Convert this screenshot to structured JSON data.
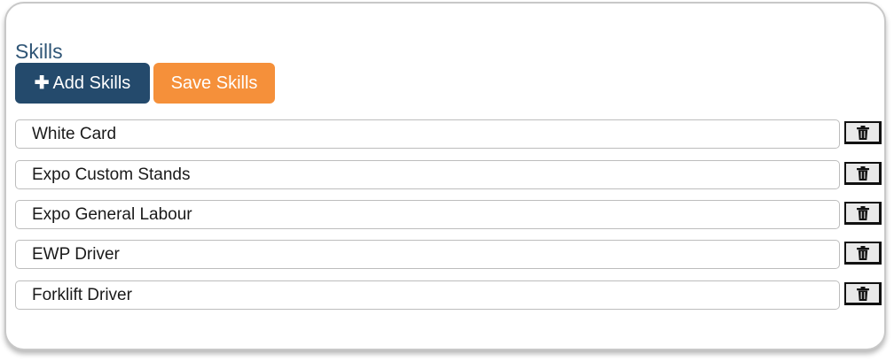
{
  "section": {
    "title": "Skills"
  },
  "buttons": {
    "add_label": "Add Skills",
    "add_icon": "plus-icon",
    "save_label": "Save Skills",
    "add_color": "#244a6c",
    "save_color": "#f5903a"
  },
  "skills": [
    {
      "value": "White Card",
      "delete_icon": "trash-icon"
    },
    {
      "value": "Expo Custom Stands",
      "delete_icon": "trash-icon"
    },
    {
      "value": "Expo General Labour",
      "delete_icon": "trash-icon"
    },
    {
      "value": "EWP Driver",
      "delete_icon": "trash-icon"
    },
    {
      "value": "Forklift Driver",
      "delete_icon": "trash-icon"
    }
  ]
}
